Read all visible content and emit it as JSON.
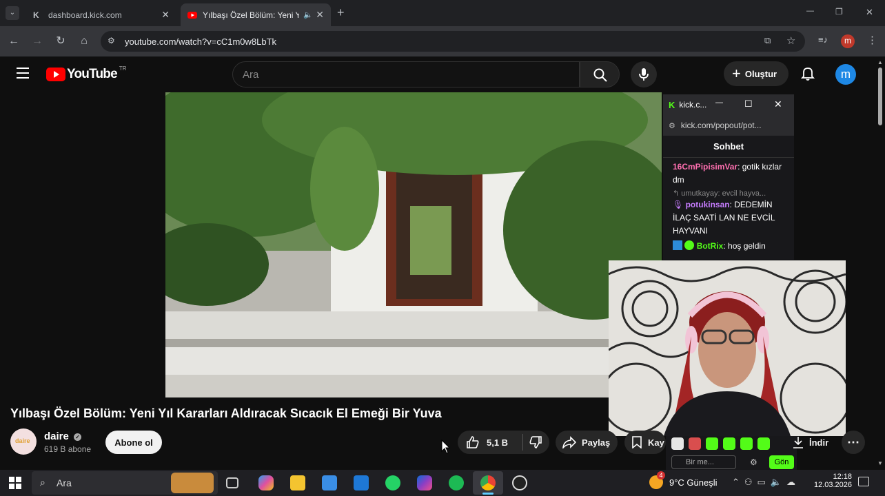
{
  "browser": {
    "tabs": [
      {
        "label": "dashboard.kick.com",
        "close": "✕"
      },
      {
        "label": "Yılbaşı Özel Bölüm: Yeni Yıl",
        "close": "✕"
      }
    ],
    "new_tab": "+",
    "url": "youtube.com/watch?v=cC1m0w8LbTk",
    "profile_initial": "m",
    "window_controls": [
      "—",
      "❐",
      "✕"
    ]
  },
  "youtube": {
    "logo_text": "YouTube",
    "region": "TR",
    "search_placeholder": "Ara",
    "create_label": "Oluştur",
    "avatar_initial": "m",
    "video_title": "Yılbaşı Özel Bölüm: Yeni Yıl Kararları Aldıracak Sıcacık El Emeği Bir Yuva",
    "channel_name": "daire",
    "channel_avatar_text": "daire",
    "subscribers": "619 B abone",
    "subscribe_label": "Abone ol",
    "likes": "5,1 B",
    "share_label": "Paylaş",
    "save_label": "Kay",
    "download_label": "İndir",
    "more_label": "⋯"
  },
  "kick_popout": {
    "window_title": "kick.c...",
    "url": "kick.com/popout/pot...",
    "chat_title": "Sohbet",
    "messages": [
      {
        "user": "16CmPipisimVar",
        "text": ": gotik kızlar dm",
        "user_color": "#ff6fb0"
      },
      {
        "reply_to": "umutkayay: evcil hayva..."
      },
      {
        "user": "potukinsan",
        "text": ": DEDEMİN İLAÇ SAATİ LAN NE EVCİL HAYVANI",
        "user_color": "#c77dff"
      },
      {
        "user": "BotRix",
        "text": ": hoş geldin",
        "user_color": "#53fc18"
      }
    ],
    "input_placeholder": "Bir me...",
    "send_label": "Gön"
  },
  "taskbar": {
    "search_label": "Ara",
    "weather": "9°C Güneşli",
    "weather_badge": "4",
    "time": "12:18",
    "date": "12.03.2026"
  }
}
